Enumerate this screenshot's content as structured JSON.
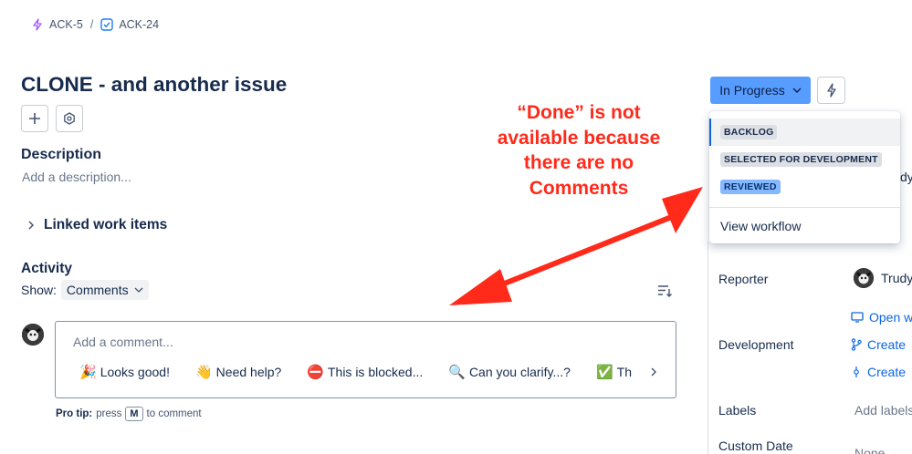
{
  "breadcrumb": {
    "parent": "ACK-5",
    "separator": "/",
    "current": "ACK-24"
  },
  "issue": {
    "title": "CLONE - and another issue"
  },
  "description": {
    "heading": "Description",
    "placeholder": "Add a description..."
  },
  "linked": {
    "label": "Linked work items"
  },
  "activity": {
    "heading": "Activity",
    "show_label": "Show:",
    "filter_value": "Comments"
  },
  "comment": {
    "placeholder": "Add a comment...",
    "quick_replies": [
      {
        "emoji": "🎉",
        "text": "Looks good!"
      },
      {
        "emoji": "👋",
        "text": "Need help?"
      },
      {
        "emoji": "⛔",
        "text": "This is blocked..."
      },
      {
        "emoji": "🔍",
        "text": "Can you clarify...?"
      },
      {
        "emoji": "✅",
        "text": "Th"
      }
    ],
    "protip_label": "Pro tip:",
    "protip_press": "press",
    "protip_key": "M",
    "protip_suffix": "to comment"
  },
  "status": {
    "current": "In Progress",
    "options": [
      "BACKLOG",
      "SELECTED FOR DEVELOPMENT",
      "REVIEWED"
    ],
    "selected_option": "BACKLOG",
    "view_workflow": "View workflow"
  },
  "details": {
    "reporter_label": "Reporter",
    "reporter_value": "Trudy",
    "assignee_partial": "dy",
    "development_label": "Development",
    "dev_open": "Open w",
    "dev_create_branch": "Create",
    "dev_create_commit": "Create",
    "labels_label": "Labels",
    "labels_value": "Add labels",
    "custom_date_label": "Custom Date",
    "custom_date_value": "None"
  },
  "annotation": {
    "line1": "“Done” is not",
    "line2": "available because",
    "line3": "there are no",
    "line4": "Comments"
  },
  "colors": {
    "status_button": "#579dff",
    "link": "#0c66e4",
    "annotation": "#ff2a1a"
  }
}
